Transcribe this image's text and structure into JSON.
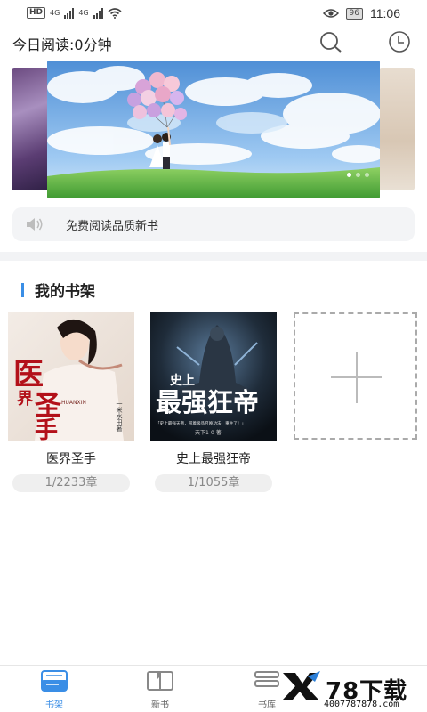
{
  "status_bar": {
    "network_badge": "HD",
    "sig1": "4G",
    "sig2": "4G",
    "battery": "96",
    "time": "11:06"
  },
  "header": {
    "today_reading": "今日阅读:0分钟"
  },
  "notice": {
    "text": "免费阅读品质新书"
  },
  "shelf": {
    "title": "我的书架",
    "books": [
      {
        "name": "医界圣手",
        "progress": "1/2233章"
      },
      {
        "name": "史上最强狂帝",
        "progress": "1/1055章"
      }
    ]
  },
  "nav": {
    "items": [
      {
        "label": "书架",
        "active": true
      },
      {
        "label": "新书",
        "active": false
      },
      {
        "label": "书库",
        "active": false
      }
    ]
  },
  "covers": {
    "book1_title_top": "医",
    "book1_title_mid": "界",
    "book1_title_bottom": "圣",
    "book1_title_last": "手",
    "book1_author": "一米水田著",
    "book1_pinyin": "HUANXIN",
    "book2_title_top": "史上",
    "book2_title_main": "最强狂帝",
    "book2_tagline": "「史上最强天帝，带着极品召唤功法，重生了！」",
    "book2_author": "天下1-0 著"
  },
  "watermark": {
    "brand": "78下载",
    "phone": "4007787878.com"
  },
  "colors": {
    "accent": "#3a8ee6",
    "sky": "#7fb6ec",
    "grass": "#5fb54a"
  }
}
